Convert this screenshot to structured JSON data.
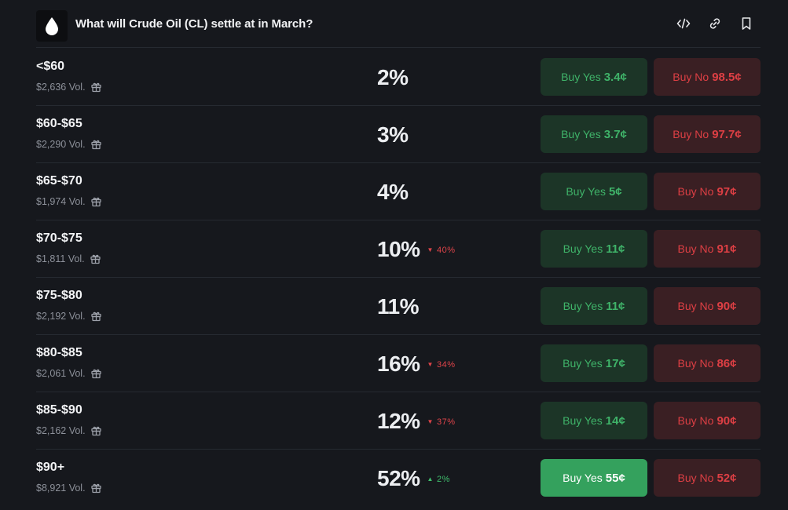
{
  "header": {
    "title": "What will Crude Oil (CL) settle at in March?"
  },
  "colors": {
    "background": "#16181d",
    "yes_bg": "#1c3527",
    "yes_text": "#3fb369",
    "yes_active_bg": "#34a15d",
    "no_bg": "#3a1f23",
    "no_text": "#dd3f44"
  },
  "rows": [
    {
      "label": "<$60",
      "volume": "$2,636 Vol.",
      "percent": "2%",
      "change": "",
      "yes_label": "Buy Yes",
      "yes_price": "3.4¢",
      "no_label": "Buy No",
      "no_price": "98.5¢"
    },
    {
      "label": "$60-$65",
      "volume": "$2,290 Vol.",
      "percent": "3%",
      "change": "",
      "yes_label": "Buy Yes",
      "yes_price": "3.7¢",
      "no_label": "Buy No",
      "no_price": "97.7¢"
    },
    {
      "label": "$65-$70",
      "volume": "$1,974 Vol.",
      "percent": "4%",
      "change": "",
      "yes_label": "Buy Yes",
      "yes_price": "5¢",
      "no_label": "Buy No",
      "no_price": "97¢"
    },
    {
      "label": "$70-$75",
      "volume": "$1,811 Vol.",
      "percent": "10%",
      "change": "40%",
      "change_dir": "down",
      "yes_label": "Buy Yes",
      "yes_price": "11¢",
      "no_label": "Buy No",
      "no_price": "91¢"
    },
    {
      "label": "$75-$80",
      "volume": "$2,192 Vol.",
      "percent": "11%",
      "change": "",
      "yes_label": "Buy Yes",
      "yes_price": "11¢",
      "no_label": "Buy No",
      "no_price": "90¢"
    },
    {
      "label": "$80-$85",
      "volume": "$2,061 Vol.",
      "percent": "16%",
      "change": "34%",
      "change_dir": "down",
      "yes_label": "Buy Yes",
      "yes_price": "17¢",
      "no_label": "Buy No",
      "no_price": "86¢"
    },
    {
      "label": "$85-$90",
      "volume": "$2,162 Vol.",
      "percent": "12%",
      "change": "37%",
      "change_dir": "down",
      "yes_label": "Buy Yes",
      "yes_price": "14¢",
      "no_label": "Buy No",
      "no_price": "90¢"
    },
    {
      "label": "$90+",
      "volume": "$8,921 Vol.",
      "percent": "52%",
      "change": "2%",
      "change_dir": "up",
      "yes_label": "Buy Yes",
      "yes_price": "55¢",
      "no_label": "Buy No",
      "no_price": "52¢",
      "yes_active": true
    }
  ]
}
